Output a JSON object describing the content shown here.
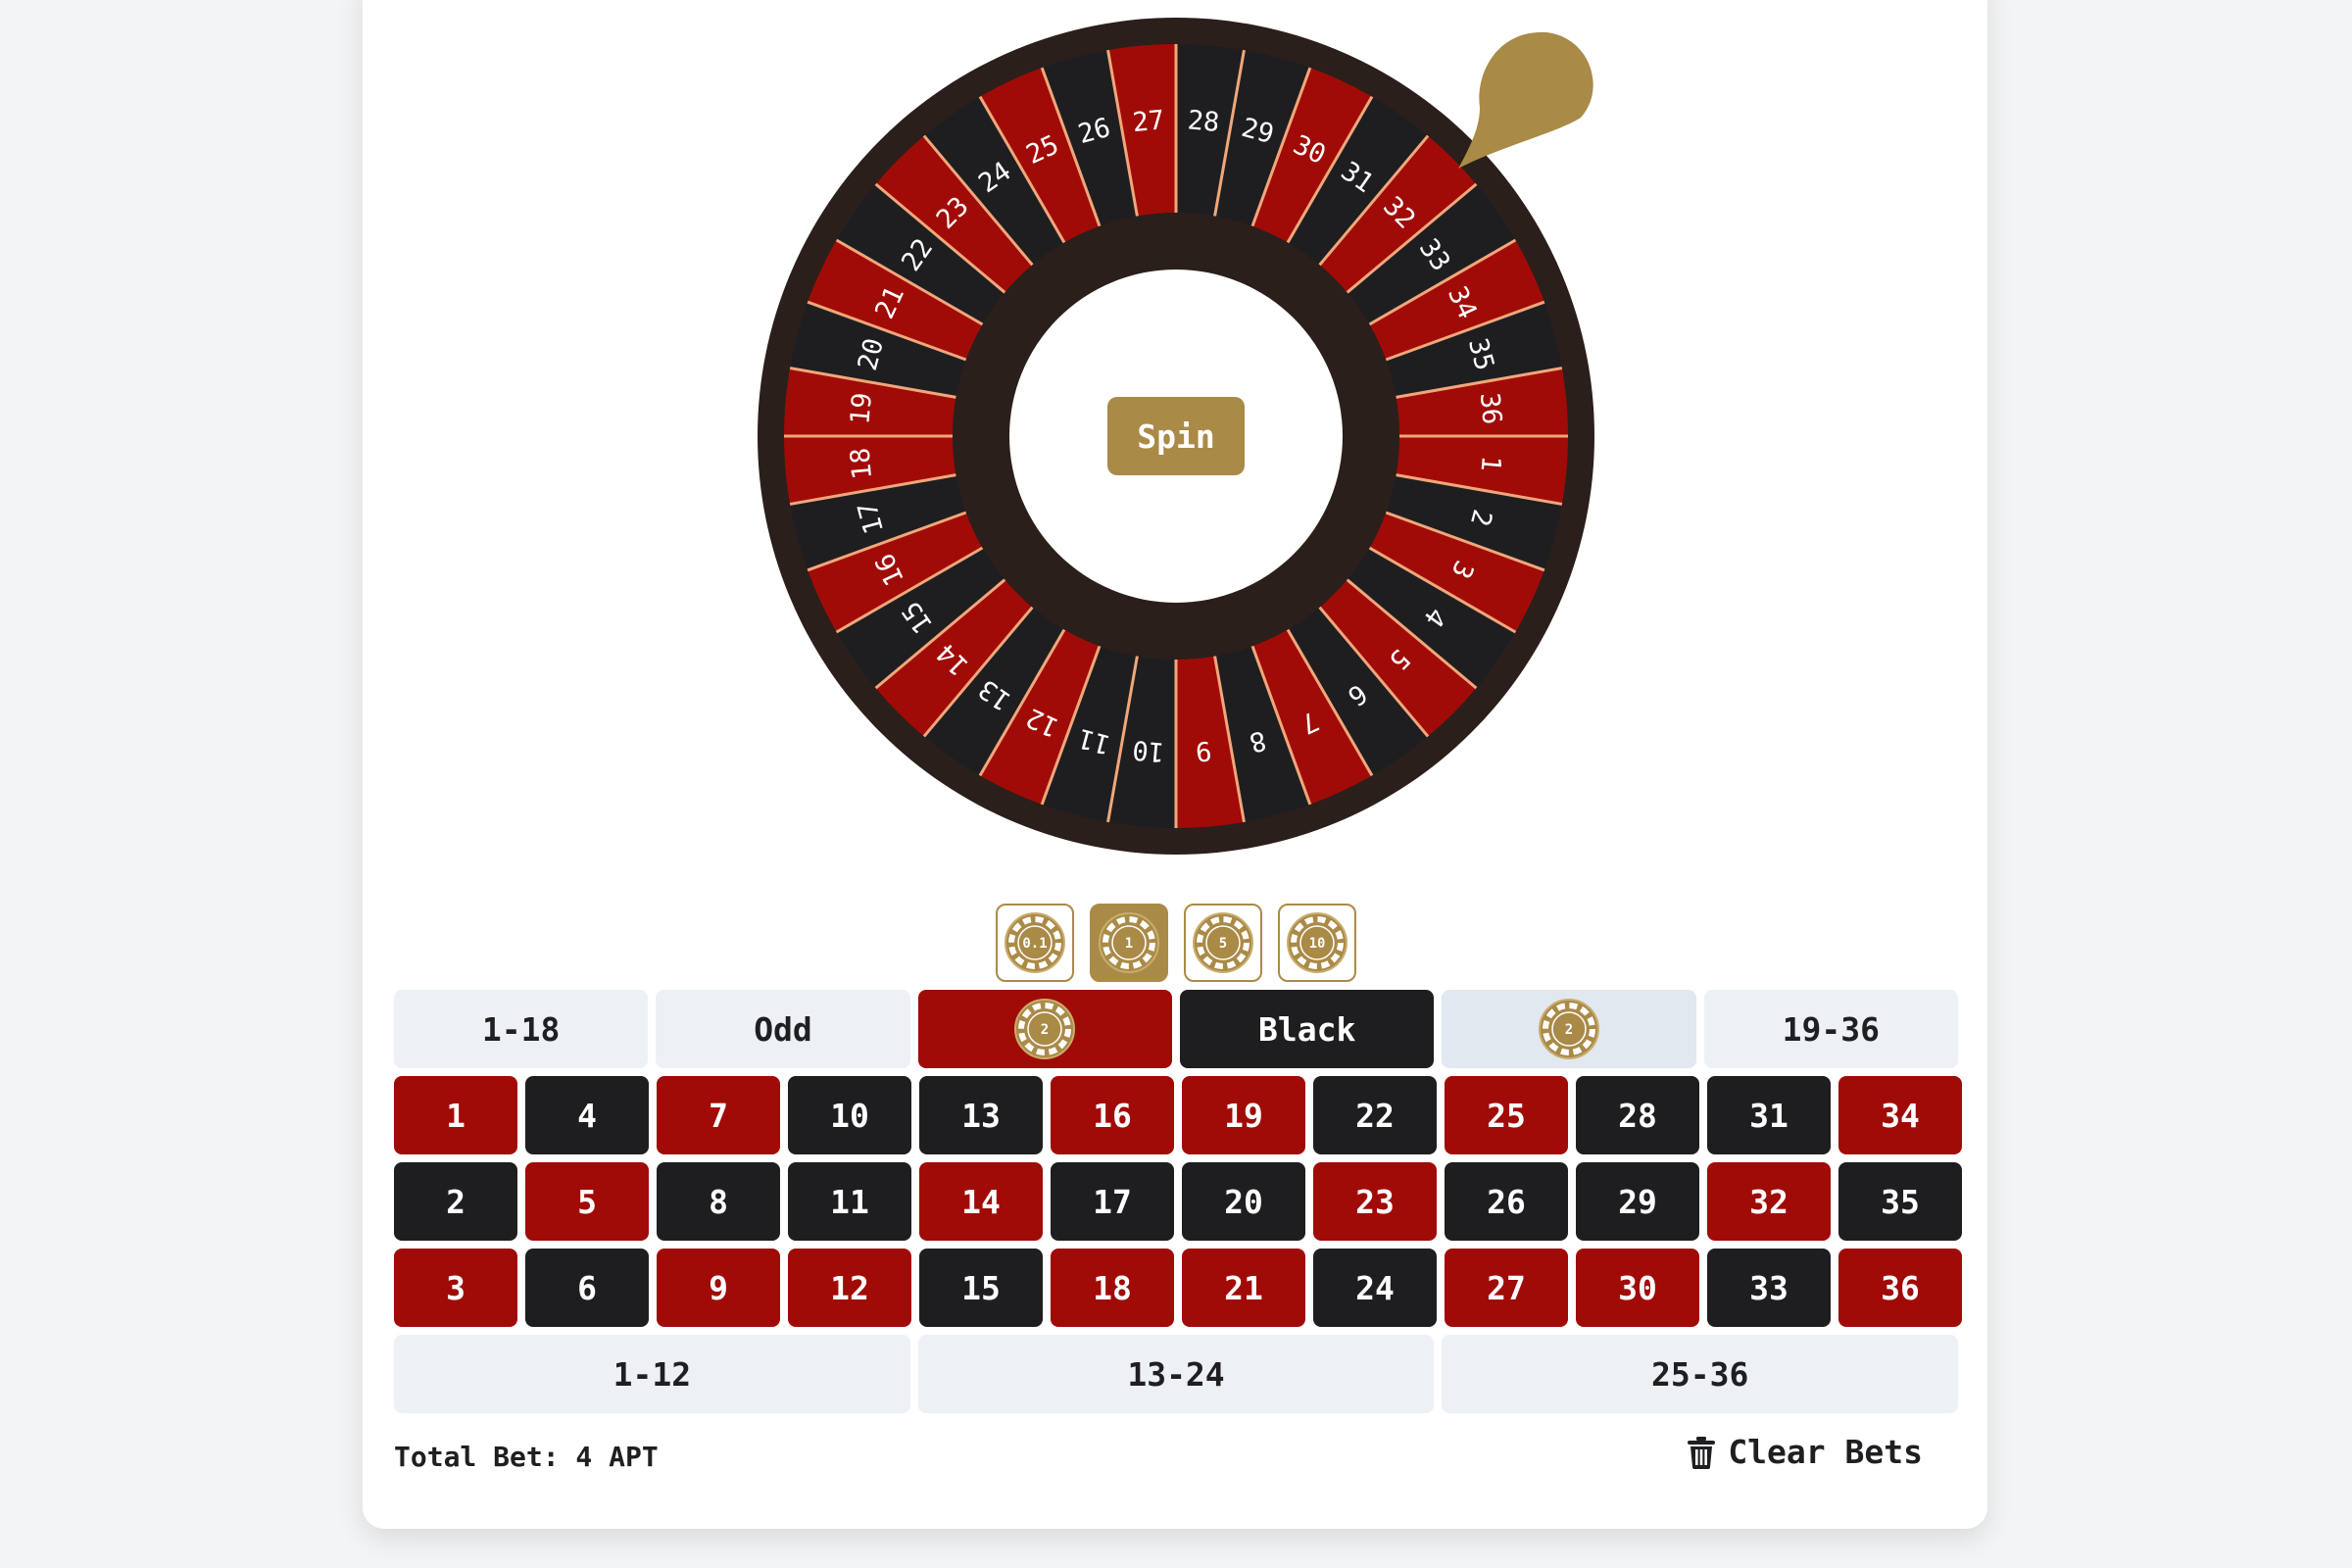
{
  "wheel": {
    "numbers": [
      28,
      29,
      30,
      31,
      32,
      33,
      34,
      35,
      36,
      1,
      2,
      3,
      4,
      5,
      6,
      7,
      8,
      9,
      10,
      11,
      12,
      13,
      14,
      15,
      16,
      17,
      18,
      19,
      20,
      21,
      22,
      23,
      24,
      25,
      26,
      27
    ],
    "colors": {
      "red": "#a10b07",
      "black": "#1e1e21",
      "rim": "#2b1f1b",
      "divider": "#f0a77a",
      "accent": "#aa8a47"
    },
    "spin_label": "Spin"
  },
  "chips": [
    {
      "label": "0.1",
      "selected": false
    },
    {
      "label": "1",
      "selected": true
    },
    {
      "label": "5",
      "selected": false
    },
    {
      "label": "10",
      "selected": false
    }
  ],
  "outside_bets": [
    {
      "label": "1-18",
      "style": "light",
      "chip": null
    },
    {
      "label": "Odd",
      "style": "light",
      "chip": null
    },
    {
      "label": "",
      "style": "red",
      "chip": "2",
      "name": "red"
    },
    {
      "label": "Black",
      "style": "black",
      "chip": null
    },
    {
      "label": "",
      "style": "light-hl",
      "chip": "2",
      "name": "even"
    },
    {
      "label": "19-36",
      "style": "light",
      "chip": null
    }
  ],
  "grid": [
    [
      {
        "n": "1",
        "c": "red"
      },
      {
        "n": "4",
        "c": "black"
      },
      {
        "n": "7",
        "c": "red"
      },
      {
        "n": "10",
        "c": "black"
      },
      {
        "n": "13",
        "c": "black"
      },
      {
        "n": "16",
        "c": "red"
      },
      {
        "n": "19",
        "c": "red"
      },
      {
        "n": "22",
        "c": "black"
      },
      {
        "n": "25",
        "c": "red"
      },
      {
        "n": "28",
        "c": "black"
      },
      {
        "n": "31",
        "c": "black"
      },
      {
        "n": "34",
        "c": "red"
      }
    ],
    [
      {
        "n": "2",
        "c": "black"
      },
      {
        "n": "5",
        "c": "red"
      },
      {
        "n": "8",
        "c": "black"
      },
      {
        "n": "11",
        "c": "black"
      },
      {
        "n": "14",
        "c": "red"
      },
      {
        "n": "17",
        "c": "black"
      },
      {
        "n": "20",
        "c": "black"
      },
      {
        "n": "23",
        "c": "red"
      },
      {
        "n": "26",
        "c": "black"
      },
      {
        "n": "29",
        "c": "black"
      },
      {
        "n": "32",
        "c": "red"
      },
      {
        "n": "35",
        "c": "black"
      }
    ],
    [
      {
        "n": "3",
        "c": "red"
      },
      {
        "n": "6",
        "c": "black"
      },
      {
        "n": "9",
        "c": "red"
      },
      {
        "n": "12",
        "c": "red"
      },
      {
        "n": "15",
        "c": "black"
      },
      {
        "n": "18",
        "c": "red"
      },
      {
        "n": "21",
        "c": "red"
      },
      {
        "n": "24",
        "c": "black"
      },
      {
        "n": "27",
        "c": "red"
      },
      {
        "n": "30",
        "c": "red"
      },
      {
        "n": "33",
        "c": "black"
      },
      {
        "n": "36",
        "c": "red"
      }
    ]
  ],
  "dozens": [
    "1-12",
    "13-24",
    "25-36"
  ],
  "footer": {
    "total_bet": "Total Bet: 4 APT",
    "clear_label": "Clear Bets"
  }
}
